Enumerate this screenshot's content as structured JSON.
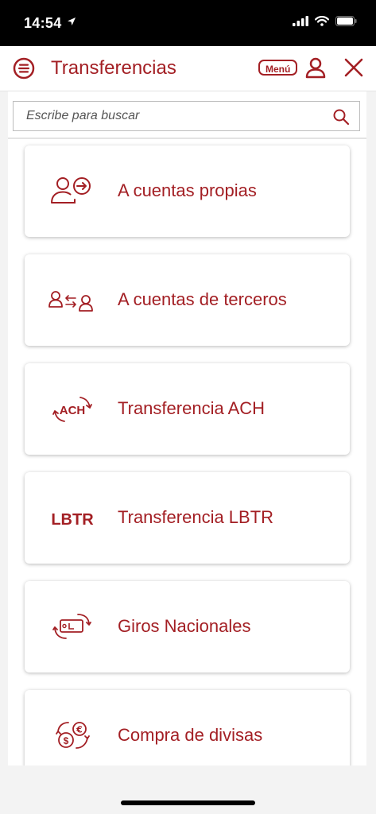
{
  "status_bar": {
    "time": "14:54"
  },
  "header": {
    "title": "Transferencias",
    "menu_label": "Menú"
  },
  "search": {
    "placeholder": "Escribe para buscar",
    "value": ""
  },
  "options": [
    {
      "label": "A cuentas propias",
      "icon": "own-accounts-icon"
    },
    {
      "label": "A cuentas de terceros",
      "icon": "third-party-transfer-icon"
    },
    {
      "label": "Transferencia ACH",
      "icon": "ach-icon",
      "icon_text": "ACH"
    },
    {
      "label": "Transferencia LBTR",
      "icon": "lbtr-icon",
      "icon_text": "LBTR"
    },
    {
      "label": "Giros Nacionales",
      "icon": "money-transfer-icon"
    },
    {
      "label": "Compra de divisas",
      "icon": "currency-exchange-icon"
    }
  ],
  "colors": {
    "brand": "#a31f24",
    "background": "#f3f3f3"
  }
}
